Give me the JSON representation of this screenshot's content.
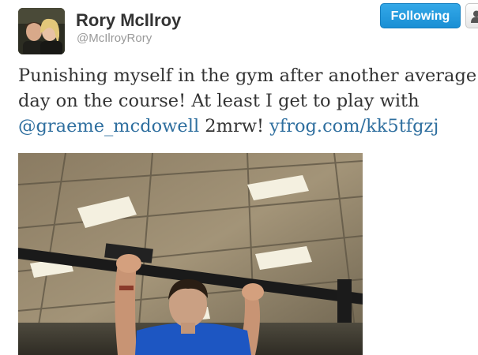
{
  "user": {
    "display_name": "Rory McIlroy",
    "handle": "@McIlroyRory"
  },
  "actions": {
    "follow_label": "Following",
    "user_action_icon": "person-icon"
  },
  "tweet": {
    "text_part1": "Punishing myself in the gym after another average",
    "text_part2": "day on the course! At least I get to play with",
    "mention": "@graeme_mcdowell",
    "text_part3": " 2mrw! ",
    "link": "yfrog.com/kk5tfgzj"
  },
  "colors": {
    "link": "#2f6f9f",
    "follow_button": "#1a8fd4",
    "text": "#333333",
    "handle": "#999999"
  }
}
